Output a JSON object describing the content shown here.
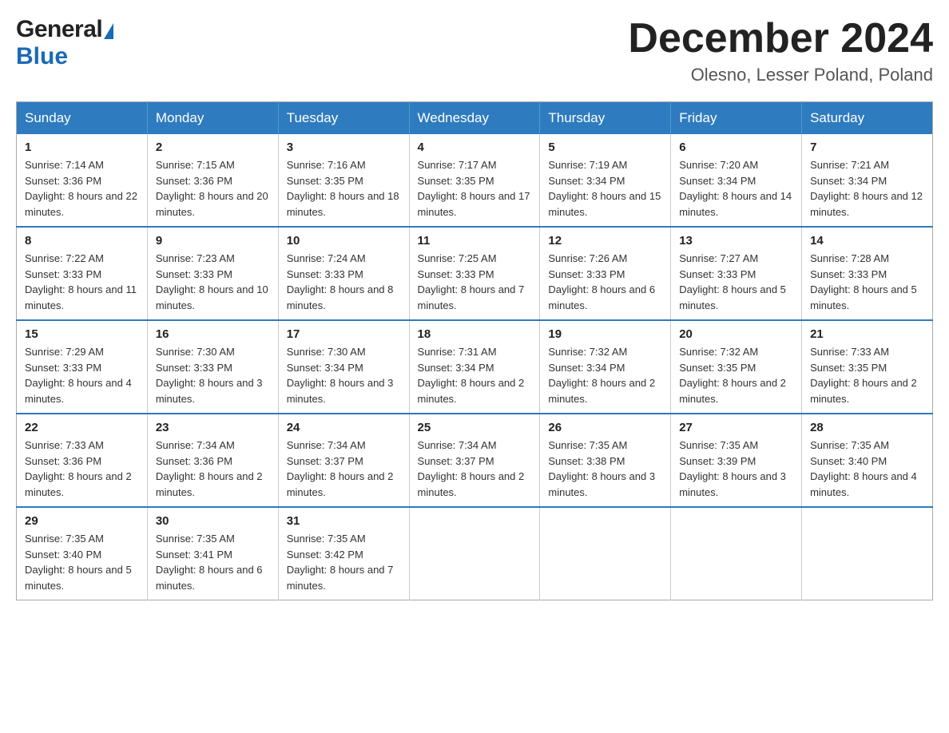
{
  "header": {
    "month_title": "December 2024",
    "location": "Olesno, Lesser Poland, Poland",
    "logo_general": "General",
    "logo_blue": "Blue"
  },
  "calendar": {
    "days_of_week": [
      "Sunday",
      "Monday",
      "Tuesday",
      "Wednesday",
      "Thursday",
      "Friday",
      "Saturday"
    ],
    "weeks": [
      [
        {
          "day": "1",
          "sunrise": "Sunrise: 7:14 AM",
          "sunset": "Sunset: 3:36 PM",
          "daylight": "Daylight: 8 hours and 22 minutes."
        },
        {
          "day": "2",
          "sunrise": "Sunrise: 7:15 AM",
          "sunset": "Sunset: 3:36 PM",
          "daylight": "Daylight: 8 hours and 20 minutes."
        },
        {
          "day": "3",
          "sunrise": "Sunrise: 7:16 AM",
          "sunset": "Sunset: 3:35 PM",
          "daylight": "Daylight: 8 hours and 18 minutes."
        },
        {
          "day": "4",
          "sunrise": "Sunrise: 7:17 AM",
          "sunset": "Sunset: 3:35 PM",
          "daylight": "Daylight: 8 hours and 17 minutes."
        },
        {
          "day": "5",
          "sunrise": "Sunrise: 7:19 AM",
          "sunset": "Sunset: 3:34 PM",
          "daylight": "Daylight: 8 hours and 15 minutes."
        },
        {
          "day": "6",
          "sunrise": "Sunrise: 7:20 AM",
          "sunset": "Sunset: 3:34 PM",
          "daylight": "Daylight: 8 hours and 14 minutes."
        },
        {
          "day": "7",
          "sunrise": "Sunrise: 7:21 AM",
          "sunset": "Sunset: 3:34 PM",
          "daylight": "Daylight: 8 hours and 12 minutes."
        }
      ],
      [
        {
          "day": "8",
          "sunrise": "Sunrise: 7:22 AM",
          "sunset": "Sunset: 3:33 PM",
          "daylight": "Daylight: 8 hours and 11 minutes."
        },
        {
          "day": "9",
          "sunrise": "Sunrise: 7:23 AM",
          "sunset": "Sunset: 3:33 PM",
          "daylight": "Daylight: 8 hours and 10 minutes."
        },
        {
          "day": "10",
          "sunrise": "Sunrise: 7:24 AM",
          "sunset": "Sunset: 3:33 PM",
          "daylight": "Daylight: 8 hours and 8 minutes."
        },
        {
          "day": "11",
          "sunrise": "Sunrise: 7:25 AM",
          "sunset": "Sunset: 3:33 PM",
          "daylight": "Daylight: 8 hours and 7 minutes."
        },
        {
          "day": "12",
          "sunrise": "Sunrise: 7:26 AM",
          "sunset": "Sunset: 3:33 PM",
          "daylight": "Daylight: 8 hours and 6 minutes."
        },
        {
          "day": "13",
          "sunrise": "Sunrise: 7:27 AM",
          "sunset": "Sunset: 3:33 PM",
          "daylight": "Daylight: 8 hours and 5 minutes."
        },
        {
          "day": "14",
          "sunrise": "Sunrise: 7:28 AM",
          "sunset": "Sunset: 3:33 PM",
          "daylight": "Daylight: 8 hours and 5 minutes."
        }
      ],
      [
        {
          "day": "15",
          "sunrise": "Sunrise: 7:29 AM",
          "sunset": "Sunset: 3:33 PM",
          "daylight": "Daylight: 8 hours and 4 minutes."
        },
        {
          "day": "16",
          "sunrise": "Sunrise: 7:30 AM",
          "sunset": "Sunset: 3:33 PM",
          "daylight": "Daylight: 8 hours and 3 minutes."
        },
        {
          "day": "17",
          "sunrise": "Sunrise: 7:30 AM",
          "sunset": "Sunset: 3:34 PM",
          "daylight": "Daylight: 8 hours and 3 minutes."
        },
        {
          "day": "18",
          "sunrise": "Sunrise: 7:31 AM",
          "sunset": "Sunset: 3:34 PM",
          "daylight": "Daylight: 8 hours and 2 minutes."
        },
        {
          "day": "19",
          "sunrise": "Sunrise: 7:32 AM",
          "sunset": "Sunset: 3:34 PM",
          "daylight": "Daylight: 8 hours and 2 minutes."
        },
        {
          "day": "20",
          "sunrise": "Sunrise: 7:32 AM",
          "sunset": "Sunset: 3:35 PM",
          "daylight": "Daylight: 8 hours and 2 minutes."
        },
        {
          "day": "21",
          "sunrise": "Sunrise: 7:33 AM",
          "sunset": "Sunset: 3:35 PM",
          "daylight": "Daylight: 8 hours and 2 minutes."
        }
      ],
      [
        {
          "day": "22",
          "sunrise": "Sunrise: 7:33 AM",
          "sunset": "Sunset: 3:36 PM",
          "daylight": "Daylight: 8 hours and 2 minutes."
        },
        {
          "day": "23",
          "sunrise": "Sunrise: 7:34 AM",
          "sunset": "Sunset: 3:36 PM",
          "daylight": "Daylight: 8 hours and 2 minutes."
        },
        {
          "day": "24",
          "sunrise": "Sunrise: 7:34 AM",
          "sunset": "Sunset: 3:37 PM",
          "daylight": "Daylight: 8 hours and 2 minutes."
        },
        {
          "day": "25",
          "sunrise": "Sunrise: 7:34 AM",
          "sunset": "Sunset: 3:37 PM",
          "daylight": "Daylight: 8 hours and 2 minutes."
        },
        {
          "day": "26",
          "sunrise": "Sunrise: 7:35 AM",
          "sunset": "Sunset: 3:38 PM",
          "daylight": "Daylight: 8 hours and 3 minutes."
        },
        {
          "day": "27",
          "sunrise": "Sunrise: 7:35 AM",
          "sunset": "Sunset: 3:39 PM",
          "daylight": "Daylight: 8 hours and 3 minutes."
        },
        {
          "day": "28",
          "sunrise": "Sunrise: 7:35 AM",
          "sunset": "Sunset: 3:40 PM",
          "daylight": "Daylight: 8 hours and 4 minutes."
        }
      ],
      [
        {
          "day": "29",
          "sunrise": "Sunrise: 7:35 AM",
          "sunset": "Sunset: 3:40 PM",
          "daylight": "Daylight: 8 hours and 5 minutes."
        },
        {
          "day": "30",
          "sunrise": "Sunrise: 7:35 AM",
          "sunset": "Sunset: 3:41 PM",
          "daylight": "Daylight: 8 hours and 6 minutes."
        },
        {
          "day": "31",
          "sunrise": "Sunrise: 7:35 AM",
          "sunset": "Sunset: 3:42 PM",
          "daylight": "Daylight: 8 hours and 7 minutes."
        },
        null,
        null,
        null,
        null
      ]
    ]
  }
}
